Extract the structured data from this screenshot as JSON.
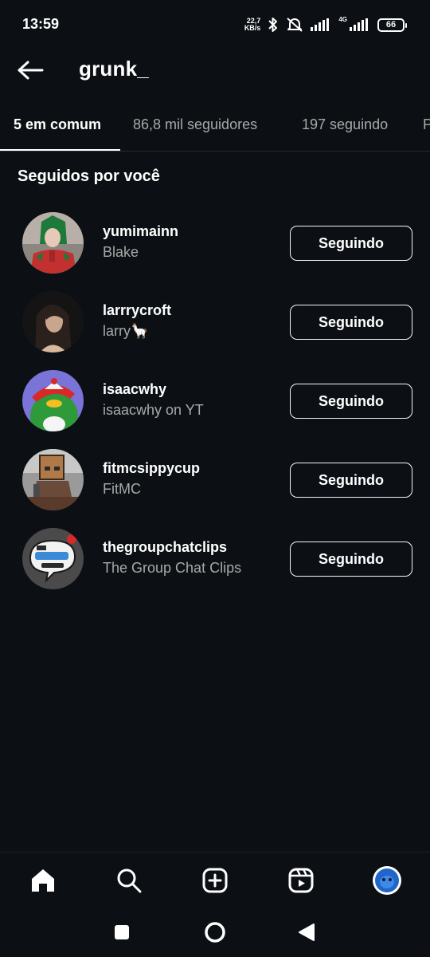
{
  "status_bar": {
    "time": "13:59",
    "net_speed_value": "22,7",
    "net_speed_unit": "KB/s",
    "network_type": "4G",
    "battery": "66"
  },
  "header": {
    "title": "grunk_"
  },
  "tabs": [
    {
      "label": "5 em comum",
      "active": true
    },
    {
      "label": "86,8 mil seguidores",
      "active": false
    },
    {
      "label": "197 seguindo",
      "active": false
    },
    {
      "label": "P",
      "active": false
    }
  ],
  "section_title": "Seguidos por você",
  "users": [
    {
      "username": "yumimainn",
      "name": "Blake",
      "button": "Seguindo"
    },
    {
      "username": "larrrycroft",
      "name": "larry🦙",
      "button": "Seguindo"
    },
    {
      "username": "isaacwhy",
      "name": "isaacwhy on YT",
      "button": "Seguindo"
    },
    {
      "username": "fitmcsippycup",
      "name": "FitMC",
      "button": "Seguindo"
    },
    {
      "username": "thegroupchatclips",
      "name": "The Group Chat Clips",
      "button": "Seguindo"
    }
  ],
  "bottom_nav": [
    "home-icon",
    "search-icon",
    "create-post-icon",
    "reels-icon",
    "profile-avatar"
  ],
  "system_nav": [
    "recents-icon",
    "home-circle-icon",
    "back-triangle-icon"
  ],
  "colors": {
    "background": "#0c1014",
    "text_primary": "#f5f5f5",
    "text_secondary": "#a8a8a8",
    "divider": "#262a30"
  }
}
